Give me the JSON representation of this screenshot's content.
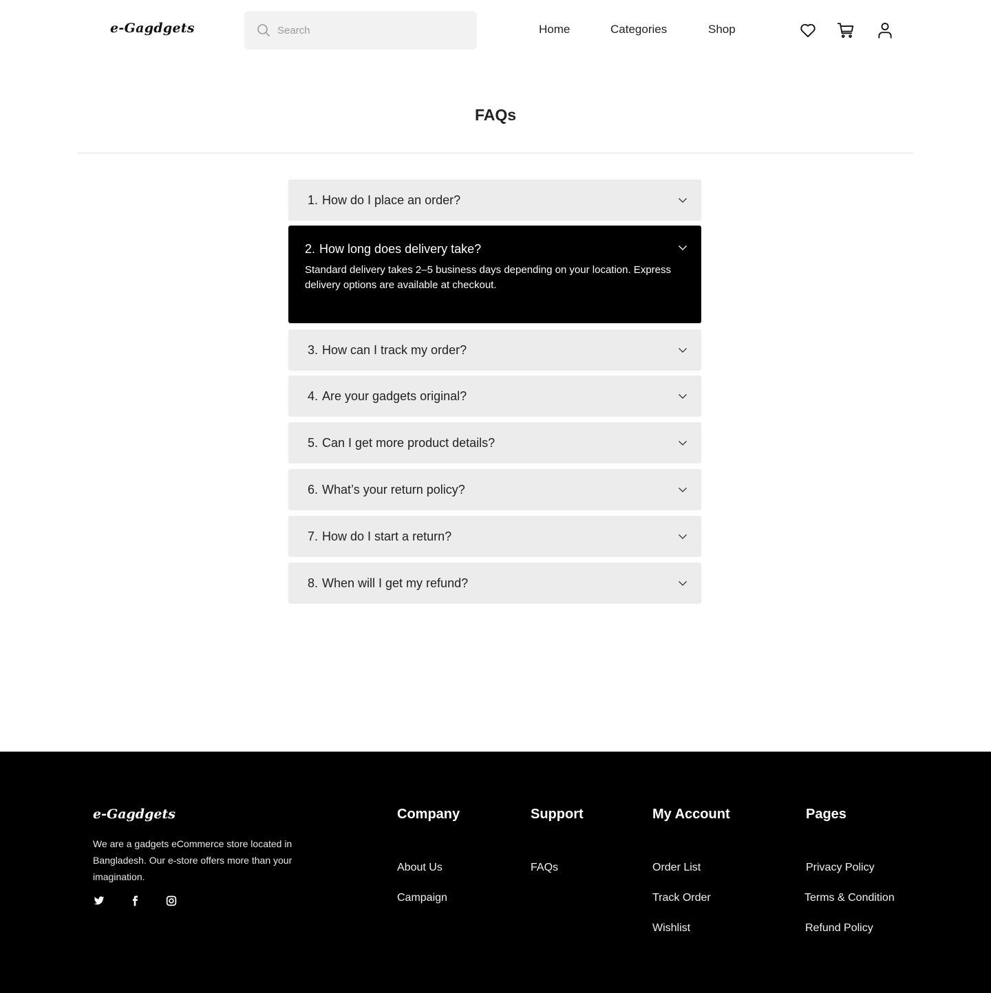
{
  "header": {
    "logo": "e-Gagdgets",
    "search_placeholder": "Search",
    "nav": [
      "Home",
      "Categories",
      "Shop"
    ],
    "icons": [
      "heart-icon",
      "cart-icon",
      "user-icon"
    ]
  },
  "page": {
    "title": "FAQs"
  },
  "faqs": [
    {
      "num": "1.",
      "question": "How do I place an order?"
    },
    {
      "num": "2.",
      "question": "How long does delivery take?",
      "answer": "Standard delivery takes 2–5 business days depending on your location. Express delivery options are available at checkout.",
      "expanded": true
    },
    {
      "num": "3.",
      "question": "How can I track my order?"
    },
    {
      "num": "4.",
      "question": "Are your gadgets original?"
    },
    {
      "num": "5.",
      "question": "Can I get more product details?"
    },
    {
      "num": "6.",
      "question": "What’s your return policy?"
    },
    {
      "num": "7.",
      "question": "How do I start a return?"
    },
    {
      "num": "8.",
      "question": "When will I get my refund?"
    }
  ],
  "footer": {
    "logo": "e-Gagdgets",
    "description": "We are a gadgets eCommerce store located in Bangladesh. Our e-store offers more than your imagination.",
    "social": [
      "twitter-icon",
      "facebook-icon",
      "instagram-icon"
    ],
    "columns": [
      {
        "title": "Company",
        "links": [
          "About Us",
          "Campaign"
        ]
      },
      {
        "title": "Support",
        "links": [
          "FAQs"
        ]
      },
      {
        "title": "My Account",
        "links": [
          "Order List",
          "Track Order",
          "Wishlist"
        ]
      },
      {
        "title": "Pages",
        "links": [
          "Privacy Policy",
          "Terms & Condition",
          "Refund Policy"
        ]
      }
    ]
  },
  "colors": {
    "footer_bg": "#000000",
    "faq_bg": "#ececec",
    "faq_active_bg": "#000000"
  }
}
